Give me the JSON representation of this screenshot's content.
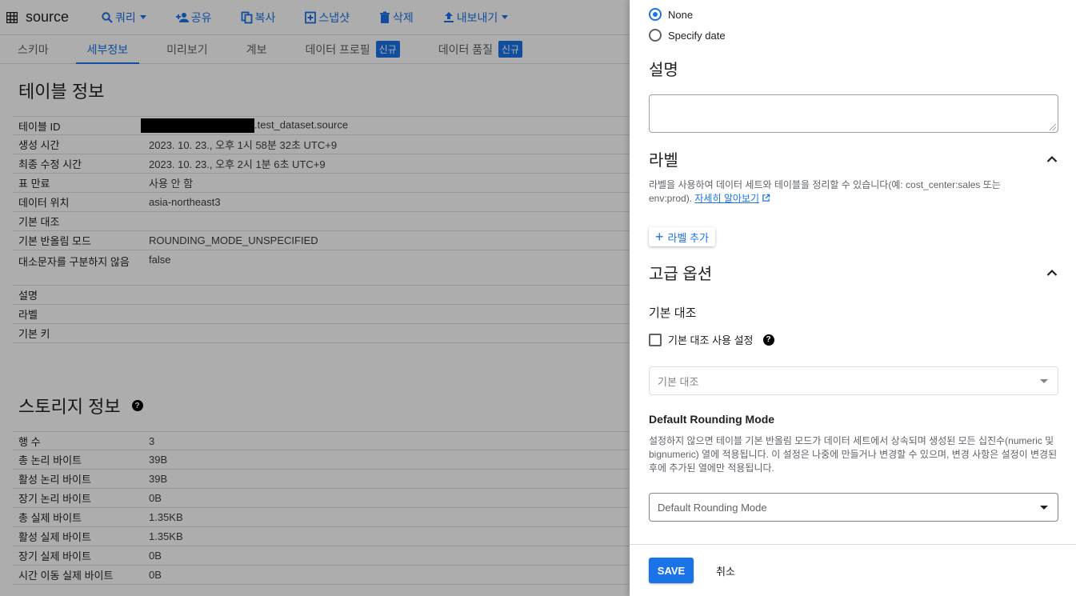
{
  "toolbar": {
    "title": "source",
    "buttons": [
      {
        "label": "쿼리",
        "icon": "search-icon",
        "dropdown": true
      },
      {
        "label": "공유",
        "icon": "person-add-icon",
        "dropdown": false
      },
      {
        "label": "복사",
        "icon": "copy-icon",
        "dropdown": false
      },
      {
        "label": "스냅샷",
        "icon": "snapshot-icon",
        "dropdown": false
      },
      {
        "label": "삭제",
        "icon": "trash-icon",
        "dropdown": false
      },
      {
        "label": "내보내기",
        "icon": "upload-icon",
        "dropdown": true
      }
    ]
  },
  "tabs": [
    {
      "label": "스키마"
    },
    {
      "label": "세부정보",
      "active": true
    },
    {
      "label": "미리보기"
    },
    {
      "label": "계보"
    },
    {
      "label": "데이터 프로필",
      "badge": "신규"
    },
    {
      "label": "데이터 품질",
      "badge": "신규"
    }
  ],
  "table_info": {
    "title": "테이블 정보",
    "rows": [
      {
        "key": "테이블 ID",
        "value": ".test_dataset.source",
        "redacted": true
      },
      {
        "key": "생성 시간",
        "value": "2023. 10. 23., 오후 1시 58분 32초 UTC+9"
      },
      {
        "key": "최종 수정 시간",
        "value": "2023. 10. 23., 오후 2시 1분 6초 UTC+9"
      },
      {
        "key": "표 만료",
        "value": "사용 안 함"
      },
      {
        "key": "데이터 위치",
        "value": "asia-northeast3"
      },
      {
        "key": "기본 대조",
        "value": ""
      },
      {
        "key": "기본 반올림 모드",
        "value": "ROUNDING_MODE_UNSPECIFIED"
      },
      {
        "key": "대소문자를 구분하지 않음",
        "value": "false"
      },
      {
        "key": "설명",
        "value": ""
      },
      {
        "key": "라벨",
        "value": ""
      },
      {
        "key": "기본 키",
        "value": ""
      }
    ]
  },
  "storage_info": {
    "title": "스토리지 정보",
    "rows": [
      {
        "key": "행 수",
        "value": "3"
      },
      {
        "key": "총 논리 바이트",
        "value": "39B"
      },
      {
        "key": "활성 논리 바이트",
        "value": "39B"
      },
      {
        "key": "장기 논리 바이트",
        "value": "0B"
      },
      {
        "key": "총 실제 바이트",
        "value": "1.35KB"
      },
      {
        "key": "활성 실제 바이트",
        "value": "1.35KB"
      },
      {
        "key": "장기 실제 바이트",
        "value": "0B"
      },
      {
        "key": "시간 이동 실제 바이트",
        "value": "0B"
      }
    ]
  },
  "panel": {
    "expiration_options": [
      {
        "label": "None",
        "selected": true
      },
      {
        "label": "Specify date",
        "selected": false
      }
    ],
    "description_title": "설명",
    "description_value": "",
    "labels_title": "라벨",
    "labels_desc": "라벨을 사용하여 데이터 세트와 테이블을 정리할 수 있습니다(예: cost_center:sales 또는 env:prod).",
    "labels_link": "자세히 알아보기",
    "add_label": "라벨 추가",
    "advanced_title": "고급 옵션",
    "collation_title": "기본 대조",
    "collation_checkbox": "기본 대조 사용 설정",
    "collation_checked": false,
    "collation_placeholder": "기본 대조",
    "rounding_title": "Default Rounding Mode",
    "rounding_desc": "설정하지 않으면 테이블 기본 반올림 모드가 데이터 세트에서 상속되며 생성된 모든 십진수(numeric 및 bignumeric) 열에 적용됩니다. 이 설정은 나중에 만들거나 변경할 수 있으며, 변경 사항은 설정이 변경된 후에 추가된 열에만 적용됩니다.",
    "rounding_placeholder": "Default Rounding Mode",
    "save": "SAVE",
    "cancel": "취소"
  },
  "colors": {
    "accent": "#1a73e8",
    "overlay": "rgba(0,0,0,0.32)"
  }
}
